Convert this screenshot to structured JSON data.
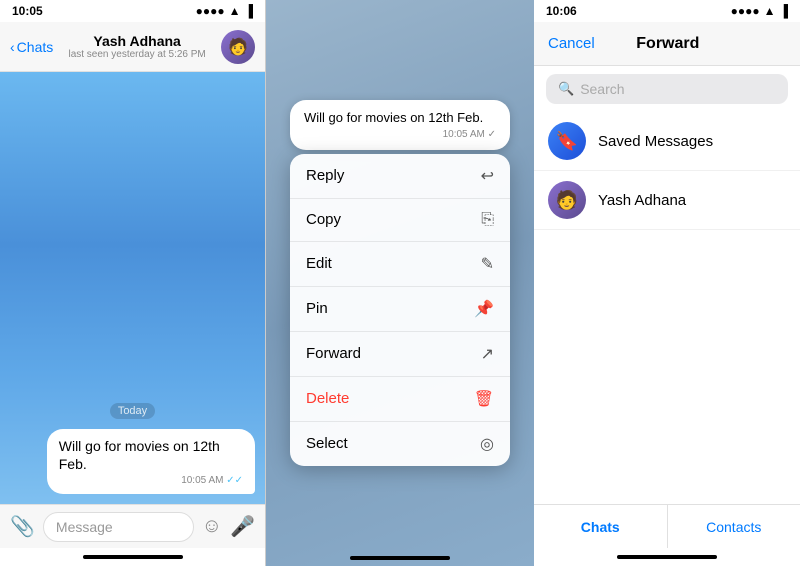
{
  "panel1": {
    "status_bar": {
      "time": "10:05",
      "signal": "●●●●",
      "wifi": "wifi",
      "battery": "battery"
    },
    "header": {
      "back_label": "Chats",
      "contact_name": "Yash Adhana",
      "status": "last seen yesterday at 5:26 PM"
    },
    "chat": {
      "date_label": "Today",
      "message_text": "Will go for movies on 12th Feb.",
      "message_time": "10:05 AM",
      "tick": "✓"
    },
    "input": {
      "placeholder": "Message"
    }
  },
  "panel2": {
    "preview": {
      "message_text": "Will go for movies on 12th Feb.",
      "message_time": "10:05 AM ✓"
    },
    "menu_items": [
      {
        "label": "Reply",
        "icon": "↩",
        "type": "normal"
      },
      {
        "label": "Copy",
        "icon": "⎘",
        "type": "normal"
      },
      {
        "label": "Edit",
        "icon": "✎",
        "type": "normal"
      },
      {
        "label": "Pin",
        "icon": "📌",
        "type": "normal"
      },
      {
        "label": "Forward",
        "icon": "↗",
        "type": "normal"
      },
      {
        "label": "Delete",
        "icon": "🗑",
        "type": "delete"
      },
      {
        "label": "Select",
        "icon": "◎",
        "type": "normal"
      }
    ]
  },
  "panel3": {
    "status_bar": {
      "time": "10:06"
    },
    "header": {
      "cancel_label": "Cancel",
      "title": "Forward"
    },
    "search": {
      "placeholder": "Search"
    },
    "contacts": [
      {
        "name": "Saved Messages",
        "type": "saved",
        "icon": "🔖"
      },
      {
        "name": "Yash Adhana",
        "type": "user",
        "icon": "👤"
      }
    ],
    "tabs": [
      {
        "label": "Chats",
        "active": true
      },
      {
        "label": "Contacts",
        "active": false
      }
    ]
  }
}
